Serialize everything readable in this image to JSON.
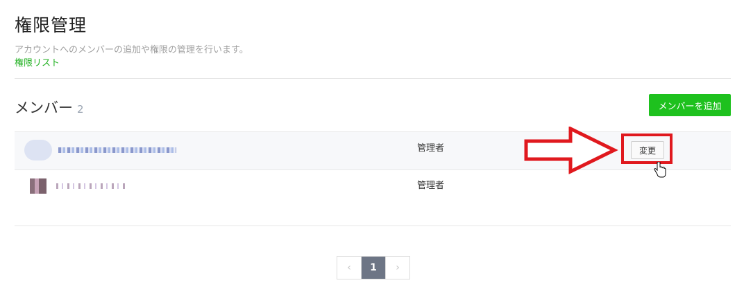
{
  "header": {
    "title": "権限管理",
    "description": "アカウントへのメンバーの追加や権限の管理を行います。",
    "permissions_link": "権限リスト"
  },
  "members": {
    "title": "メンバー",
    "count": "2",
    "add_button": "メンバーを追加",
    "rows": [
      {
        "role": "管理者",
        "action": "変更"
      },
      {
        "role": "管理者"
      }
    ]
  },
  "pagination": {
    "prev": "‹",
    "current": "1",
    "next": "›"
  },
  "colors": {
    "accent_green": "#1ec11e",
    "highlight_red": "#e0191e",
    "active_page": "#6d7585"
  }
}
